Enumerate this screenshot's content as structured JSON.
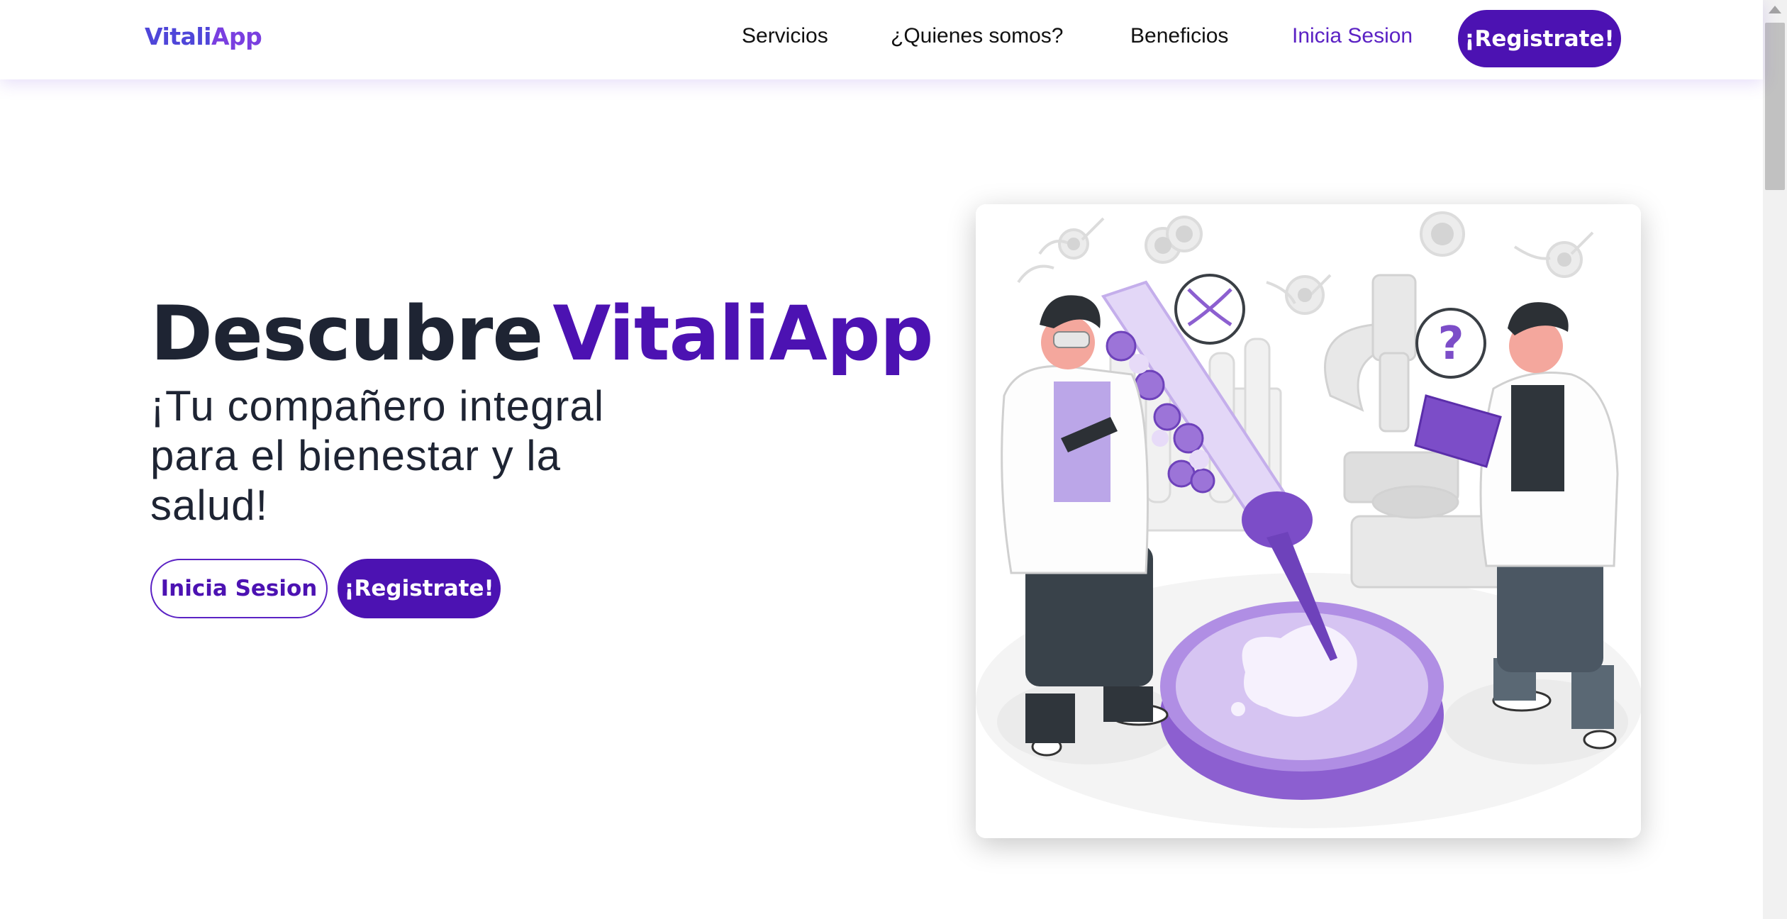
{
  "brand": {
    "logo_part1": "Vitali",
    "logo_part2": "App"
  },
  "nav": {
    "links": [
      "Servicios",
      "¿Quienes somos?",
      "Beneficios"
    ],
    "login": "Inicia Sesion",
    "register": "¡Registrate!"
  },
  "hero": {
    "title_part1": "Descubre",
    "title_part2": "VitaliApp",
    "subtitle": "¡Tu compañero integral para el bienestar y la salud!",
    "login_button": "Inicia Sesion",
    "register_button": "¡Registrate!"
  },
  "illustration": {
    "bubble_symbol": "?"
  },
  "colors": {
    "primary": "#4c12b2",
    "accent_link": "#5b22c4",
    "text_dark": "#1e2433",
    "illustration_purple": "#7c4dc8"
  }
}
